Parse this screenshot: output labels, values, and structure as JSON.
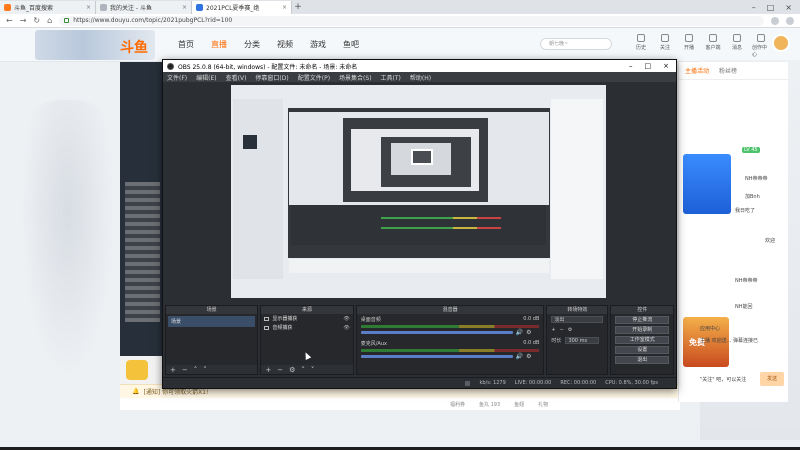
{
  "browser": {
    "tabs": [
      {
        "label": "斗鱼_百度搜索",
        "active": false
      },
      {
        "label": "我的关注 - 斗鱼",
        "active": false
      },
      {
        "label": "2021PCL夏季赛_绝",
        "active": true
      }
    ],
    "url": "https://www.douyu.com/topic/2021pubgPCL?rid=100"
  },
  "site": {
    "logo": "斗鱼",
    "nav": [
      "首页",
      "直播",
      "分类",
      "视频",
      "游戏",
      "鱼吧"
    ],
    "search_placeholder": "朝七晚~",
    "user_icons": [
      "历史",
      "关注",
      "开播",
      "客户端",
      "消息",
      "创作中心"
    ]
  },
  "obs": {
    "title": "OBS 25.0.8 (64-bit, windows) - 配置文件: 未命名 - 场景: 未命名",
    "menu": [
      "文件(F)",
      "编辑(E)",
      "查看(V)",
      "停靠窗口(D)",
      "配置文件(P)",
      "场景集合(S)",
      "工具(T)",
      "帮助(H)"
    ],
    "docks": {
      "scenes": {
        "title": "场景",
        "items": [
          "场景"
        ]
      },
      "sources": {
        "title": "来源",
        "items": [
          "显示器捕获",
          "音频捕获"
        ]
      },
      "mixer": {
        "title": "混音器",
        "channels": [
          {
            "name": "桌面音频",
            "db": "0.0 dB"
          },
          {
            "name": "麦克风/Aux",
            "db": "0.0 dB"
          }
        ]
      },
      "transitions": {
        "title": "转场特效",
        "type": "淡出",
        "duration_label": "时长",
        "duration": "300 ms"
      },
      "controls": {
        "title": "控件",
        "buttons": [
          "停止推流",
          "开始录制",
          "工作室模式",
          "设置",
          "退出"
        ]
      }
    },
    "status": {
      "dropped": "LIVE: 00:00:00",
      "rec": "REC: 00:00:00",
      "cpu": "CPU: 0.8%, 30.00 fps",
      "kbps": "kb/s: 1279"
    }
  },
  "stream": {
    "notice": "[通知] 你可领取火箭X1!",
    "stats": [
      "福利券",
      "鱼丸 193",
      "鱼翅",
      "礼物"
    ]
  },
  "chat": {
    "tabs": [
      "主播活动",
      "粉丝榜"
    ],
    "messages": [
      "NH帝帝帝",
      "NH帝帝帝",
      "加Bnh",
      "我日吃了",
      "欢迎",
      "NH帝帝帝",
      "NH帝帝帝",
      "NH能回",
      "应用中心",
      "主播 欢迎送... 弹幕连接已",
      "\"关注\" 吧，可以关注"
    ],
    "ad_text": "免费",
    "level": "LV 45",
    "send": "发送"
  },
  "colors": {
    "accent": "#ff6a00",
    "obs_bg": "#2b2e33"
  }
}
